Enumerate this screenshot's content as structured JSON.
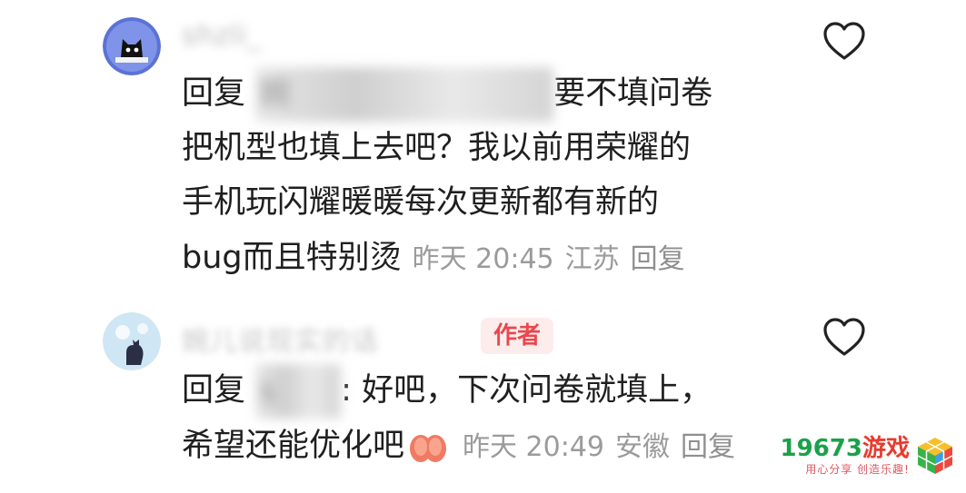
{
  "comments": [
    {
      "username": "shzli_",
      "reply_prefix": "回复",
      "mention": "婉",
      "text_after_mention": "要不填问卷",
      "lines": [
        "把机型也填上去吧？我以前用荣耀的",
        "手机玩闪耀暖暖每次更新都有新的",
        "bug而且特别烫"
      ],
      "time": "昨天 20:45",
      "location": "江苏",
      "reply_label": "回复"
    },
    {
      "username": "婉儿说现实的话",
      "badge": "作者",
      "reply_prefix": "回复",
      "mention": "s",
      "text_after_mention": ": 好吧，下次问卷就填上，",
      "line2": "希望还能优化吧",
      "time": "昨天 20:49",
      "location": "安徽",
      "reply_label": "回复"
    }
  ],
  "watermark": {
    "title_num": "19673",
    "title_cn": "游戏",
    "slogan": "用心分享 创造乐趣!"
  }
}
